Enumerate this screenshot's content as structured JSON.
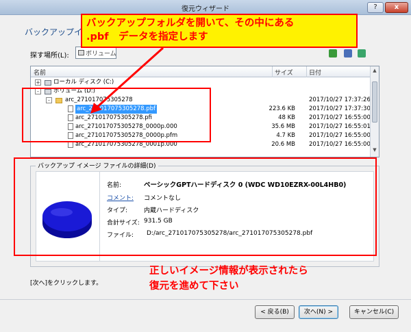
{
  "window": {
    "title": "復元ウィザード",
    "help_label": "?",
    "close_label": "x"
  },
  "header": {
    "subtitle": "バックアップイメー"
  },
  "look_in": {
    "label": "探す場所(L):",
    "value": "ボリューム (D:)"
  },
  "file_list": {
    "columns": [
      "名前",
      "サイズ",
      "日付"
    ],
    "rows": [
      {
        "name": "ローカル ディスク (C:)",
        "size": "",
        "date": "",
        "type": "drive",
        "expander": "+"
      },
      {
        "name": "ボリューム (D:)",
        "size": "",
        "date": "",
        "type": "drive",
        "expander": "-"
      },
      {
        "name": "arc_271017075305278",
        "size": "",
        "date": "2017/10/27 17:37:26",
        "type": "folder",
        "expander": "-"
      },
      {
        "name": "arc_271017075305278.pbf",
        "size": "223.6 KB",
        "date": "2017/10/27 17:37:30",
        "type": "file",
        "selected": true
      },
      {
        "name": "arc_271017075305278.pfi",
        "size": "48 KB",
        "date": "2017/10/27 16:55:00",
        "type": "file"
      },
      {
        "name": "arc_271017075305278_0000p.000",
        "size": "35.6 MB",
        "date": "2017/10/27 16:55:01",
        "type": "file"
      },
      {
        "name": "arc_271017075305278_0000p.pfm",
        "size": "4.7 KB",
        "date": "2017/10/27 16:55:00",
        "type": "file"
      },
      {
        "name": "arc_271017075305278_0001p.000",
        "size": "20.6 MB",
        "date": "2017/10/27 16:55:00",
        "type": "file"
      }
    ]
  },
  "details": {
    "legend": "バックアップ イメージ ファイルの詳細(D)",
    "name_label": "名前:",
    "name_value": "ベーシックGPTハードディスク 0 (WDC WD10EZRX-00L4HB0)",
    "comment_label": "コメント:",
    "comment_value": "コメントなし",
    "type_label": "タイプ:",
    "type_value": "内蔵ハードディスク",
    "size_label": "合計サイズ:",
    "size_value": "931.5 GB",
    "file_label": "ファイル:",
    "file_value": "D:/arc_271017075305278/arc_271017075305278.pbf"
  },
  "hint": "[次へ]をクリックします。",
  "buttons": {
    "back": "< 戻る(B)",
    "next": "次へ(N) >",
    "cancel": "キャンセル(C)"
  },
  "annotations": {
    "top_line1": "バックアップフォルダを開いて、その中にある",
    "top_line2": ".pbf　データを指定します",
    "bottom_line1": "正しいイメージ情報が表示されたら",
    "bottom_line2": "復元を進めて下さい"
  },
  "colors": {
    "annotation_red": "#ff0000",
    "annotation_yellow": "#fff200",
    "disk_blue": "#1a1ad6",
    "selection_blue": "#3399ff"
  },
  "icons": [
    "folder-icon",
    "drive-icon",
    "file-icon",
    "disk-icon",
    "arrow-icon"
  ]
}
